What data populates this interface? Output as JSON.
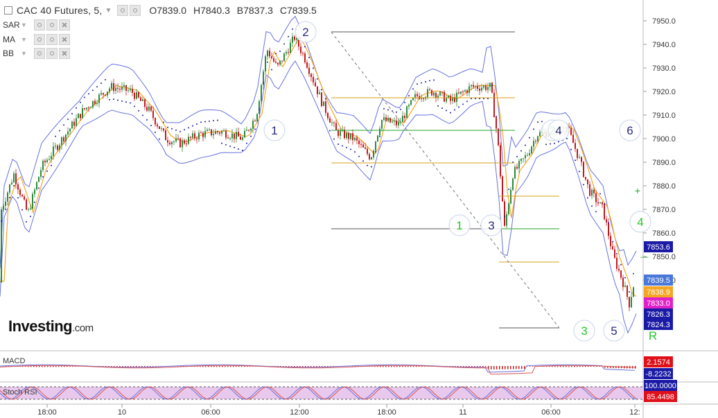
{
  "header": {
    "title": "CAC 40 Futures, 5,",
    "open": "O7839.0",
    "high": "H7840.3",
    "bid": "B7837.3",
    "close": "C7839.5"
  },
  "indicators": [
    {
      "label": "SAR"
    },
    {
      "label": "MA"
    },
    {
      "label": "BB"
    }
  ],
  "logo": {
    "brand": "Investing",
    "suffix": ".com"
  },
  "price_axis": {
    "ticks": [
      "7950.0",
      "7940.0",
      "7930.0",
      "7920.0",
      "7910.0",
      "7900.0",
      "7890.0",
      "7880.0",
      "7870.0",
      "7860.0",
      "7850.0",
      "7840.0"
    ],
    "badges": [
      {
        "text": "7853.6",
        "color": "#1a1aa6"
      },
      {
        "text": "7839.5",
        "color": "#4a78d8"
      },
      {
        "text": "7838.9",
        "color": "#f5a623"
      },
      {
        "text": "7833.0",
        "color": "#e020c8"
      },
      {
        "text": "7826.3",
        "color": "#1a1aa6"
      },
      {
        "text": "7824.3",
        "color": "#1a1aa6"
      }
    ]
  },
  "time_axis": [
    "18:00",
    "10",
    "06:00",
    "12:00",
    "18:00",
    "11",
    "06:00",
    "12:"
  ],
  "wave_labels": [
    {
      "text": "1",
      "color": "#2a2a7a"
    },
    {
      "text": "2",
      "color": "#2a2a7a"
    },
    {
      "text": "1",
      "color": "#22c52a"
    },
    {
      "text": "3",
      "color": "#2a2a7a"
    },
    {
      "text": "2",
      "color": "#22c52a"
    },
    {
      "text": "4",
      "color": "#2a2a7a"
    },
    {
      "text": "6",
      "color": "#2a2a7a"
    },
    {
      "text": "4",
      "color": "#22c52a"
    },
    {
      "text": "3",
      "color": "#22c52a"
    },
    {
      "text": "5",
      "color": "#2a2a7a"
    },
    {
      "text": "R",
      "color": "#22c52a"
    }
  ],
  "macd": {
    "label": "MACD",
    "values": [
      {
        "text": "2.1574",
        "color": "#e0101a"
      },
      {
        "text": "-8.2232",
        "color": "#1a1aa6"
      }
    ]
  },
  "stoch": {
    "label": "Stoch RSI",
    "values": [
      {
        "text": "100.0000",
        "color": "#1a1aa6"
      },
      {
        "text": "85.4498",
        "color": "#e0101a"
      }
    ]
  },
  "colors": {
    "up": "#2a8a3a",
    "down": "#c0181e",
    "band": "#6670e0",
    "ma": "#f5a623",
    "sar": "#1a1aa6",
    "fib_orange": "#d4a017",
    "fib_green": "#22a02a",
    "grid": "#666666"
  }
}
